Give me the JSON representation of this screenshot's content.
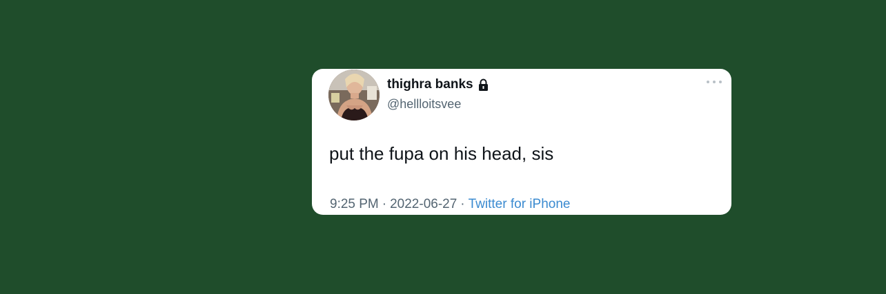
{
  "page": {
    "background_color": "#1f4d2b"
  },
  "tweet": {
    "display_name": "thighra banks",
    "protected_icon": "lock-icon",
    "handle": "@hellloitsvee",
    "text": "put the fupa on his head, sis",
    "time": "9:25 PM",
    "separator": "·",
    "date": "2022-06-27",
    "source": "Twitter for iPhone",
    "source_color": "#3a8ad0",
    "more_icon": "more-horizontal-icon"
  }
}
